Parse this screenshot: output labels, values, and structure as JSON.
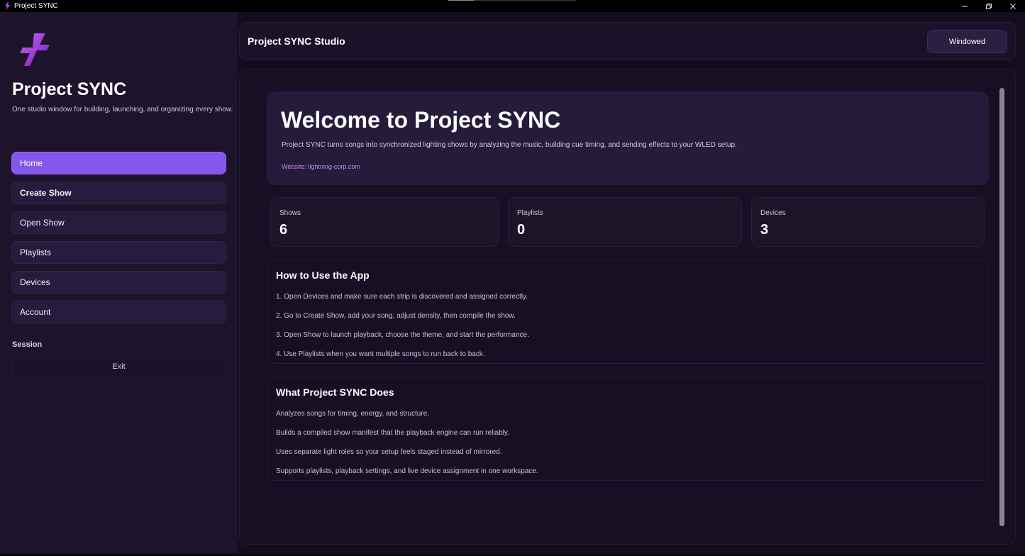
{
  "window": {
    "title": "Project SYNC",
    "icons": {
      "app": "lightning-bolt-icon",
      "minimize": "minimize-icon",
      "restore": "restore-icon",
      "close": "close-icon"
    }
  },
  "sidebar": {
    "logo_icon": "lightning-bolt-icon",
    "title": "Project SYNC",
    "subtitle": "One studio window for building, launching, and organizing every show.",
    "nav": [
      {
        "label": "Home",
        "active": true
      },
      {
        "label": "Create Show"
      },
      {
        "label": "Open Show"
      },
      {
        "label": "Playlists"
      },
      {
        "label": "Devices"
      },
      {
        "label": "Account"
      }
    ],
    "session_label": "Session",
    "exit_label": "Exit"
  },
  "header": {
    "title": "Project SYNC Studio",
    "window_mode_label": "Windowed"
  },
  "welcome": {
    "title": "Welcome to Project SYNC",
    "description": "Project SYNC turns songs into synchronized lighting shows by analyzing the music, building cue timing, and sending effects to your WLED setup.",
    "website": "Website: lightning-corp.com"
  },
  "stats": [
    {
      "label": "Shows",
      "value": "6"
    },
    {
      "label": "Playlists",
      "value": "0"
    },
    {
      "label": "Devices",
      "value": "3"
    }
  ],
  "how_to": {
    "title": "How to Use the App",
    "steps": [
      "1. Open Devices and make sure each strip is discovered and assigned correctly.",
      "2. Go to Create Show, add your song, adjust density, then compile the show.",
      "3. Open Show to launch playback, choose the theme, and start the performance.",
      "4. Use Playlists when you want multiple songs to run back to back."
    ]
  },
  "what_it_does": {
    "title": "What Project SYNC Does",
    "items": [
      "Analyzes songs for timing, energy, and structure.",
      "Builds a compiled show manifest that the playback engine can run reliably.",
      "Uses separate light roles so your setup feels staged instead of mirrored.",
      "Supports playlists, playback settings, and live device assignment in one workspace."
    ]
  },
  "colors": {
    "accent": "#8456ea",
    "link": "#c48df2",
    "sidebar_bg": "#1d142c",
    "app_bg": "#130d1d"
  }
}
